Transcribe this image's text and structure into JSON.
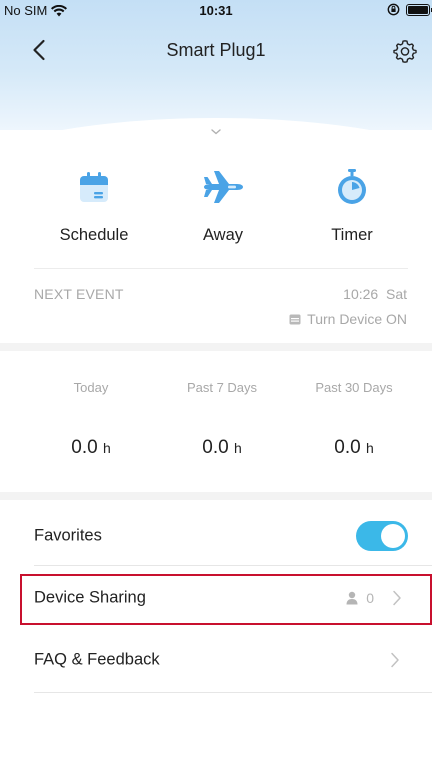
{
  "status_bar": {
    "carrier": "No SIM",
    "time": "10:31"
  },
  "header": {
    "title": "Smart Plug1"
  },
  "quick_actions": [
    {
      "label": "Schedule",
      "icon": "calendar-icon"
    },
    {
      "label": "Away",
      "icon": "airplane-icon"
    },
    {
      "label": "Timer",
      "icon": "stopwatch-icon"
    }
  ],
  "next_event": {
    "label": "NEXT EVENT",
    "time": "10:26  Sat",
    "action": "Turn Device ON"
  },
  "stats": [
    {
      "label": "Today",
      "value": "0.0",
      "unit": "h"
    },
    {
      "label": "Past 7 Days",
      "value": "0.0",
      "unit": "h"
    },
    {
      "label": "Past 30 Days",
      "value": "0.0",
      "unit": "h"
    }
  ],
  "settings_rows": {
    "favorites": {
      "label": "Favorites",
      "enabled": true
    },
    "device_sharing": {
      "label": "Device Sharing",
      "count": "0"
    },
    "faq": {
      "label": "FAQ & Feedback"
    }
  },
  "colors": {
    "accent": "#3bb8e8",
    "icon_blue": "#4aa3e6",
    "highlight": "#c8102e",
    "muted_text": "#a8a8a8"
  }
}
